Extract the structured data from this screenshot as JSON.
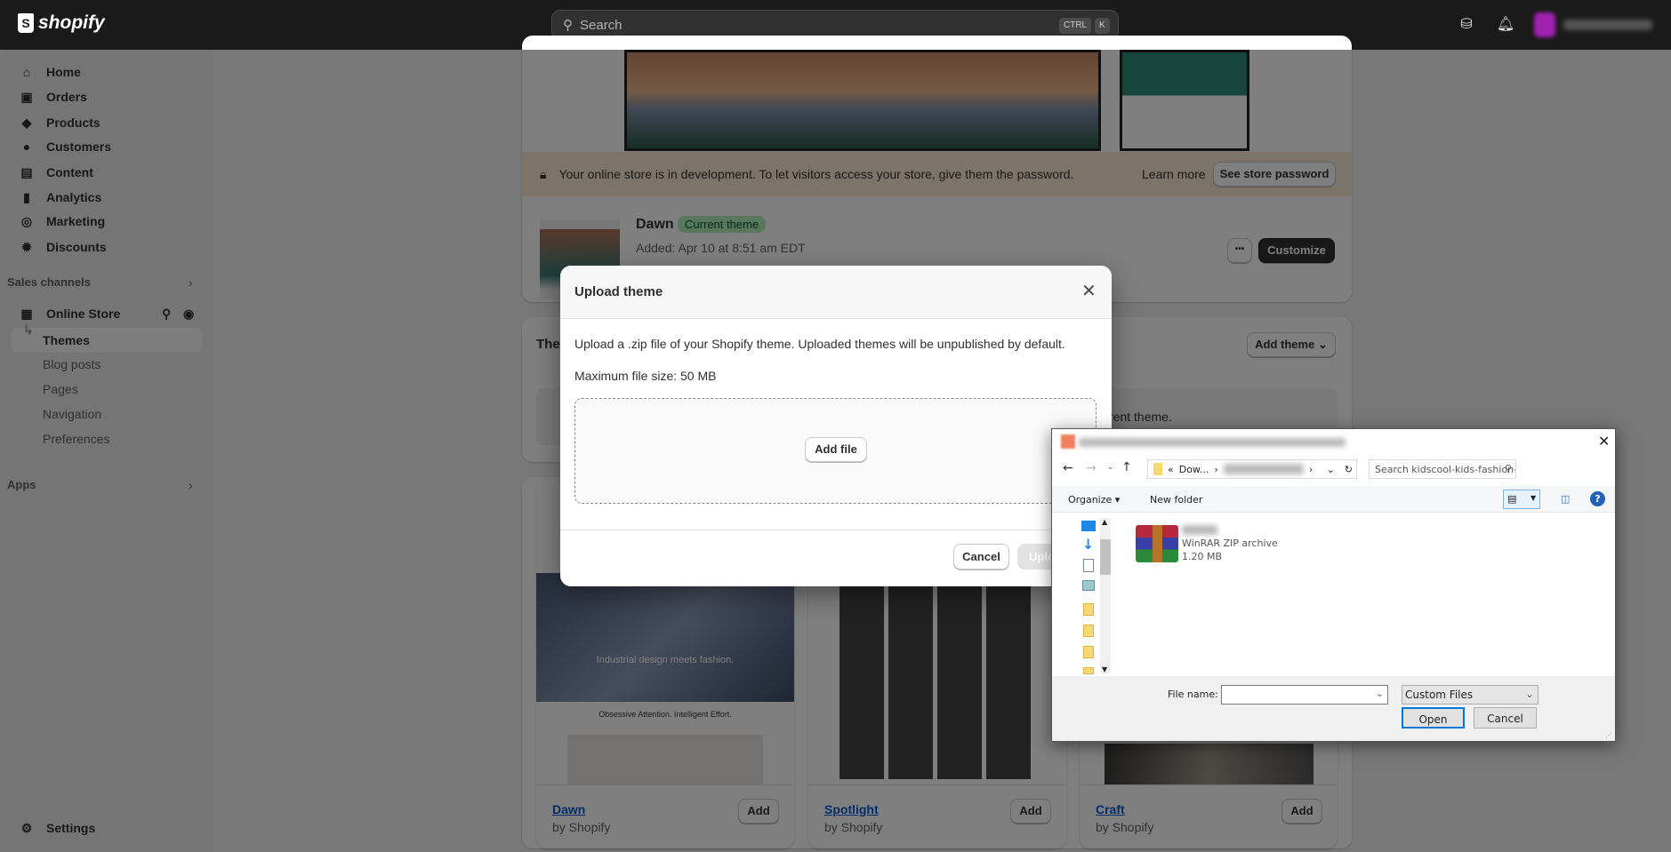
{
  "topbar": {
    "logo": "shopify",
    "search_placeholder": "Search",
    "kbd": [
      "CTRL",
      "K"
    ],
    "icons": [
      "store-icon",
      "bell-icon"
    ],
    "colors": {
      "bg": "#1a1a1a"
    }
  },
  "sidebar": {
    "items": [
      {
        "label": "Home",
        "icon": "home-icon",
        "glyph": "⌂"
      },
      {
        "label": "Orders",
        "icon": "inbox-icon",
        "glyph": "▣"
      },
      {
        "label": "Products",
        "icon": "tag-icon",
        "glyph": "◆"
      },
      {
        "label": "Customers",
        "icon": "person-icon",
        "glyph": "●"
      },
      {
        "label": "Content",
        "icon": "image-icon",
        "glyph": "▤"
      },
      {
        "label": "Analytics",
        "icon": "bar-chart-icon",
        "glyph": "▮"
      },
      {
        "label": "Marketing",
        "icon": "target-icon",
        "glyph": "◎"
      },
      {
        "label": "Discounts",
        "icon": "discount-icon",
        "glyph": "✹"
      }
    ],
    "sales_channels": "Sales channels",
    "online_store": "Online Store",
    "sub_items": [
      "Themes",
      "Blog posts",
      "Pages",
      "Navigation",
      "Preferences"
    ],
    "apps": "Apps",
    "settings": "Settings"
  },
  "main": {
    "banner": {
      "text": "Your online store is in development. To let visitors access your store, give them the password.",
      "learn_more": "Learn more",
      "button": "See store password"
    },
    "current_theme": {
      "name": "Dawn",
      "badge": "Current theme",
      "added": "Added: Apr 10 at 8:51 am EDT",
      "more": "•••",
      "customize": "Customize"
    },
    "library": {
      "title": "The",
      "add_theme": "Add theme",
      "hint": "rent theme."
    },
    "themes": [
      {
        "name": "Dawn",
        "by": "by Shopify",
        "add": "Add",
        "tagline": "Industrial design meets fashion.",
        "sub": "Obsessive Attention. Intelligent Effort."
      },
      {
        "name": "Spotlight",
        "by": "by Shopify",
        "add": "Add"
      },
      {
        "name": "Craft",
        "by": "by Shopify",
        "add": "Add"
      }
    ]
  },
  "modal": {
    "title": "Upload theme",
    "description": "Upload a .zip file of your Shopify theme. Uploaded themes will be unpublished by default.",
    "max_size": "Maximum file size: 50 MB",
    "add_file": "Add file",
    "cancel": "Cancel",
    "upload": "Upload"
  },
  "file_dialog": {
    "path_prefix": "«",
    "path_folder": "Dow...",
    "search_placeholder": "Search kidscool-kids-fashion-...",
    "organize": "Organize ▾",
    "new_folder": "New folder",
    "file": {
      "type": "WinRAR ZIP archive",
      "size": "1.20 MB"
    },
    "file_name_label": "File name:",
    "file_name_value": "",
    "file_type": "Custom Files",
    "open": "Open",
    "cancel": "Cancel"
  }
}
